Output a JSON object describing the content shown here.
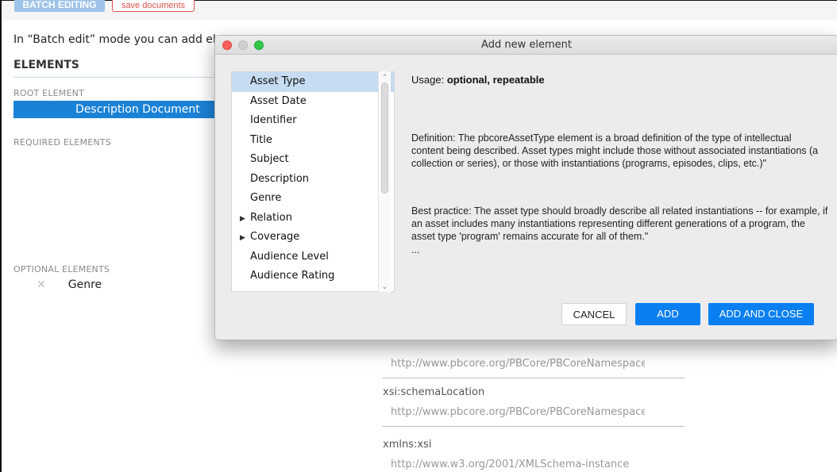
{
  "header": {
    "batch_editing_label": "BATCH EDITING",
    "save_documents_label": "save documents",
    "info_text": "In “Batch edit” mode you can add eleme"
  },
  "elements": {
    "title": "ELEMENTS",
    "root_label": "ROOT ELEMENT",
    "root_value": "Description Document",
    "required_label": "REQUIRED ELEMENTS",
    "optional_label": "OPTIONAL ELEMENTS",
    "optional_items": [
      {
        "remove_glyph": "✕",
        "label": "Genre"
      }
    ]
  },
  "attributes": [
    {
      "label": "",
      "value": "http://www.pbcore.org/PBCore/PBCoreNamespace"
    },
    {
      "label": "xsi:schemaLocation",
      "value": "http://www.pbcore.org/PBCore/PBCoreNamespace"
    },
    {
      "label": "xmlns:xsi",
      "value": "http://www.w3.org/2001/XMLSchema-instance"
    }
  ],
  "dialog": {
    "title": "Add new element",
    "list_items": [
      {
        "label": "Asset Type",
        "selected": true,
        "expandable": false
      },
      {
        "label": "Asset Date",
        "selected": false,
        "expandable": false
      },
      {
        "label": "Identifier",
        "selected": false,
        "expandable": false
      },
      {
        "label": "Title",
        "selected": false,
        "expandable": false
      },
      {
        "label": "Subject",
        "selected": false,
        "expandable": false
      },
      {
        "label": "Description",
        "selected": false,
        "expandable": false
      },
      {
        "label": "Genre",
        "selected": false,
        "expandable": false
      },
      {
        "label": "Relation",
        "selected": false,
        "expandable": true
      },
      {
        "label": "Coverage",
        "selected": false,
        "expandable": true
      },
      {
        "label": "Audience Level",
        "selected": false,
        "expandable": false
      },
      {
        "label": "Audience Rating",
        "selected": false,
        "expandable": false
      }
    ],
    "usage_prefix": "Usage: ",
    "usage_value": "optional, repeatable",
    "definition": "Definition: The pbcoreAssetType element is a broad definition of the type of intellectual content being described. Asset types might include those without associated instantiations (a collection or series), or those with instantiations (programs, episodes, clips, etc.)\"",
    "best_practice": "Best practice: The asset type should broadly describe all related instantiations -- for example, if an asset includes many instantiations representing different generations of a program, the asset type 'program' remains accurate for all of them.\"",
    "ellipsis": "...",
    "cancel_label": "CANCEL",
    "add_label": "ADD",
    "add_close_label": "ADD AND CLOSE"
  },
  "colors": {
    "accent": "#0a7ff2",
    "root_highlight": "#1a82d6",
    "selected_row": "#c6dcf2",
    "save_docs_border": "#d9534f"
  },
  "icons": {
    "remove": "close-icon",
    "expand": "triangle-right-icon",
    "scroll_up": "chevron-up-icon",
    "scroll_down": "chevron-down-icon"
  }
}
